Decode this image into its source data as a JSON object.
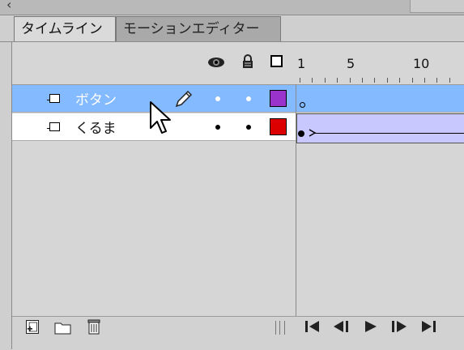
{
  "tabs": [
    {
      "label": "タイムライン",
      "active": true
    },
    {
      "label": "モーションエディター",
      "active": false
    }
  ],
  "header": {
    "eye_icon": "eye-icon",
    "lock_icon": "lock-icon",
    "outline_icon": "outline-icon"
  },
  "ruler": {
    "labels": [
      "1",
      "5",
      "10"
    ]
  },
  "layers": [
    {
      "name": "ボタン",
      "selected": true,
      "color": "#9933cc",
      "icon": "layer-icon"
    },
    {
      "name": "くるま",
      "selected": false,
      "color": "#dd0000",
      "icon": "layer-icon"
    }
  ],
  "colors": {
    "selection": "#84baff",
    "tween": "#c8c8ff",
    "panel": "#d6d6d6"
  },
  "bottom_icons": [
    "new-layer-icon",
    "new-folder-icon",
    "trash-icon"
  ],
  "playback_icons": [
    "go-to-first-frame-icon",
    "step-back-icon",
    "play-icon",
    "step-forward-icon",
    "go-to-last-frame-icon"
  ]
}
